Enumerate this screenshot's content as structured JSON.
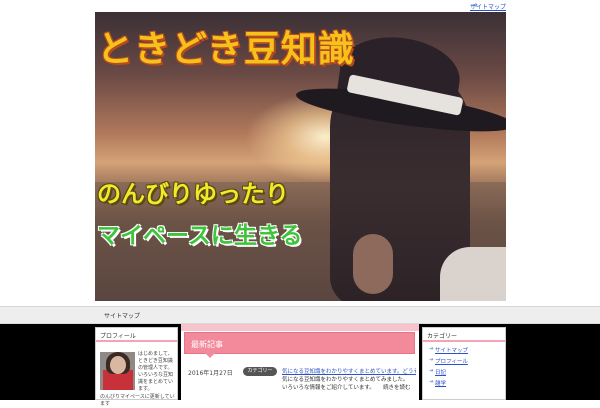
{
  "topbar": {
    "link_label": "サイトマップ",
    "arrow_icon": "arrow-right-icon"
  },
  "header": {
    "title": "ときどき豆知識",
    "subtitle_line1": "のんびりゆったり",
    "subtitle_line2": "マイペースに生きる",
    "colors": {
      "title": "#f4c21b",
      "sub1": "#f2e92a",
      "sub2": "#3ec43a"
    }
  },
  "navbar": {
    "items": [
      "サイトマップ"
    ]
  },
  "sidebar_left": {
    "heading": "プロフィール",
    "profile_text": "はじめまして、ときどき豆知識の管理人です。いろいろな豆知識をまとめています。",
    "profile_text_2": "のんびりマイペースに更新しています"
  },
  "main": {
    "category_heading": "最新記事",
    "post": {
      "date": "2016年1月27日",
      "tag": "カテゴリー",
      "title": "気になる豆知識をわかりやすくまとめています。どうぞご覧ください",
      "excerpt": "気になる豆知識をわかりやすくまとめてみました。　　いろいろな情報をご紹介しています。　　続きを読む"
    },
    "colors": {
      "heading_bg": "#f28a9c",
      "link": "#2b52c9"
    }
  },
  "sidebar_right": {
    "heading": "カテゴリー",
    "items": [
      "サイトマップ",
      "プロフィール",
      "日記",
      "雑学"
    ]
  }
}
